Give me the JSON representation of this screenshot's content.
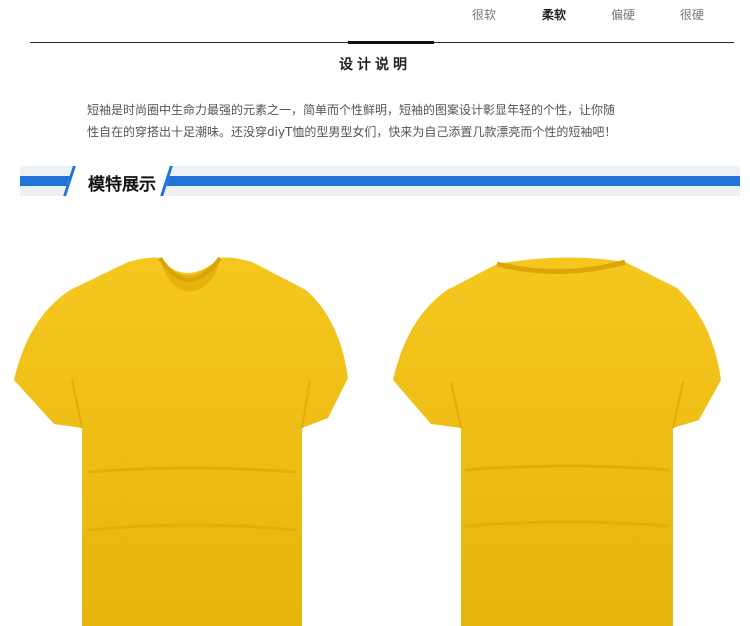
{
  "softness_scale": {
    "levels": [
      "很软",
      "柔软",
      "偏硬",
      "很硬"
    ],
    "selected": "柔软"
  },
  "section_title": "设计说明",
  "description": {
    "line1": "短袖是时尚圈中生命力最强的元素之一，简单而个性鲜明，短袖的图案设计彰显年轻的个性，让你随",
    "line2": "性自在的穿搭出十足潮味。还没穿diyT恤的型男型女们，快来为自己添置几款漂亮而个性的短袖吧！"
  },
  "banner": {
    "label": "模特展示"
  },
  "colors": {
    "accent": "#1f73d9",
    "shirt": "#f2c21a"
  },
  "photos": [
    {
      "name": "yellow-tshirt-front"
    },
    {
      "name": "yellow-tshirt-back"
    }
  ]
}
